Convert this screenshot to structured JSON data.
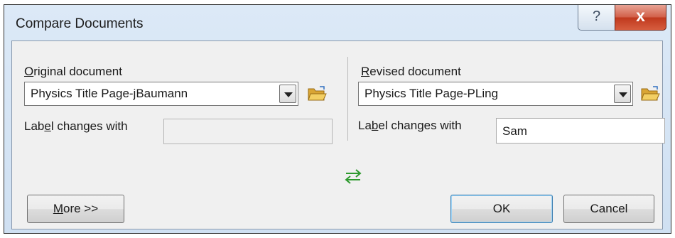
{
  "window": {
    "title": "Compare Documents",
    "help_glyph": "?",
    "close_glyph": "x"
  },
  "original": {
    "heading_first_letter": "O",
    "heading_rest": "riginal document",
    "selected_document": "Physics Title Page-jBaumann",
    "label_changes_pre": "Lab",
    "label_changes_accel": "e",
    "label_changes_post": "l changes with",
    "label_changes_value": ""
  },
  "revised": {
    "heading_first_letter": "R",
    "heading_rest": "evised document",
    "selected_document": "Physics Title Page-PLing",
    "label_changes_pre": "La",
    "label_changes_accel": "b",
    "label_changes_post": "el changes with",
    "label_changes_value": "Sam"
  },
  "buttons": {
    "more_accel": "M",
    "more_rest": "ore >>",
    "ok": "OK",
    "cancel": "Cancel"
  },
  "icons": {
    "help": "help-icon",
    "close": "close-icon",
    "open_folder": "open-folder-icon",
    "swap": "swap-documents-icon",
    "dropdown": "dropdown-arrow-icon"
  },
  "colors": {
    "titlebar_bg": "#dce9f7",
    "close_red": "#c0391e",
    "swap_green": "#2e9a2e"
  }
}
